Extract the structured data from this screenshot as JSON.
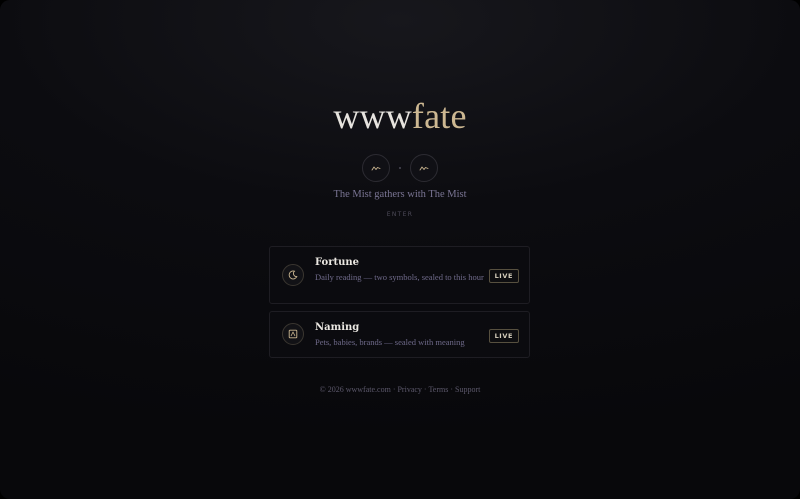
{
  "brand": {
    "prefix": "www",
    "accent": "fate",
    "prefix_color": "#e6e3de",
    "accent_color": "#cdb892"
  },
  "symbols": [
    {
      "icon": "squiggle-icon"
    },
    {
      "icon": "squiggle-icon"
    }
  ],
  "tagline": "The Mist gathers with The Mist",
  "enter_label": "ENTER",
  "cards": [
    {
      "title": "Fortune",
      "icon": "moon-icon",
      "description": "Daily reading — two symbols, sealed to this hour",
      "badge": "LIVE"
    },
    {
      "title": "Naming",
      "icon": "name-tag-icon",
      "description": "Pets, babies, brands — sealed with meaning",
      "badge": "LIVE"
    }
  ],
  "footer": {
    "copyright": "© 2026 wwwfate.com",
    "separator": " · ",
    "links": [
      "Privacy",
      "Terms",
      "Support"
    ]
  }
}
